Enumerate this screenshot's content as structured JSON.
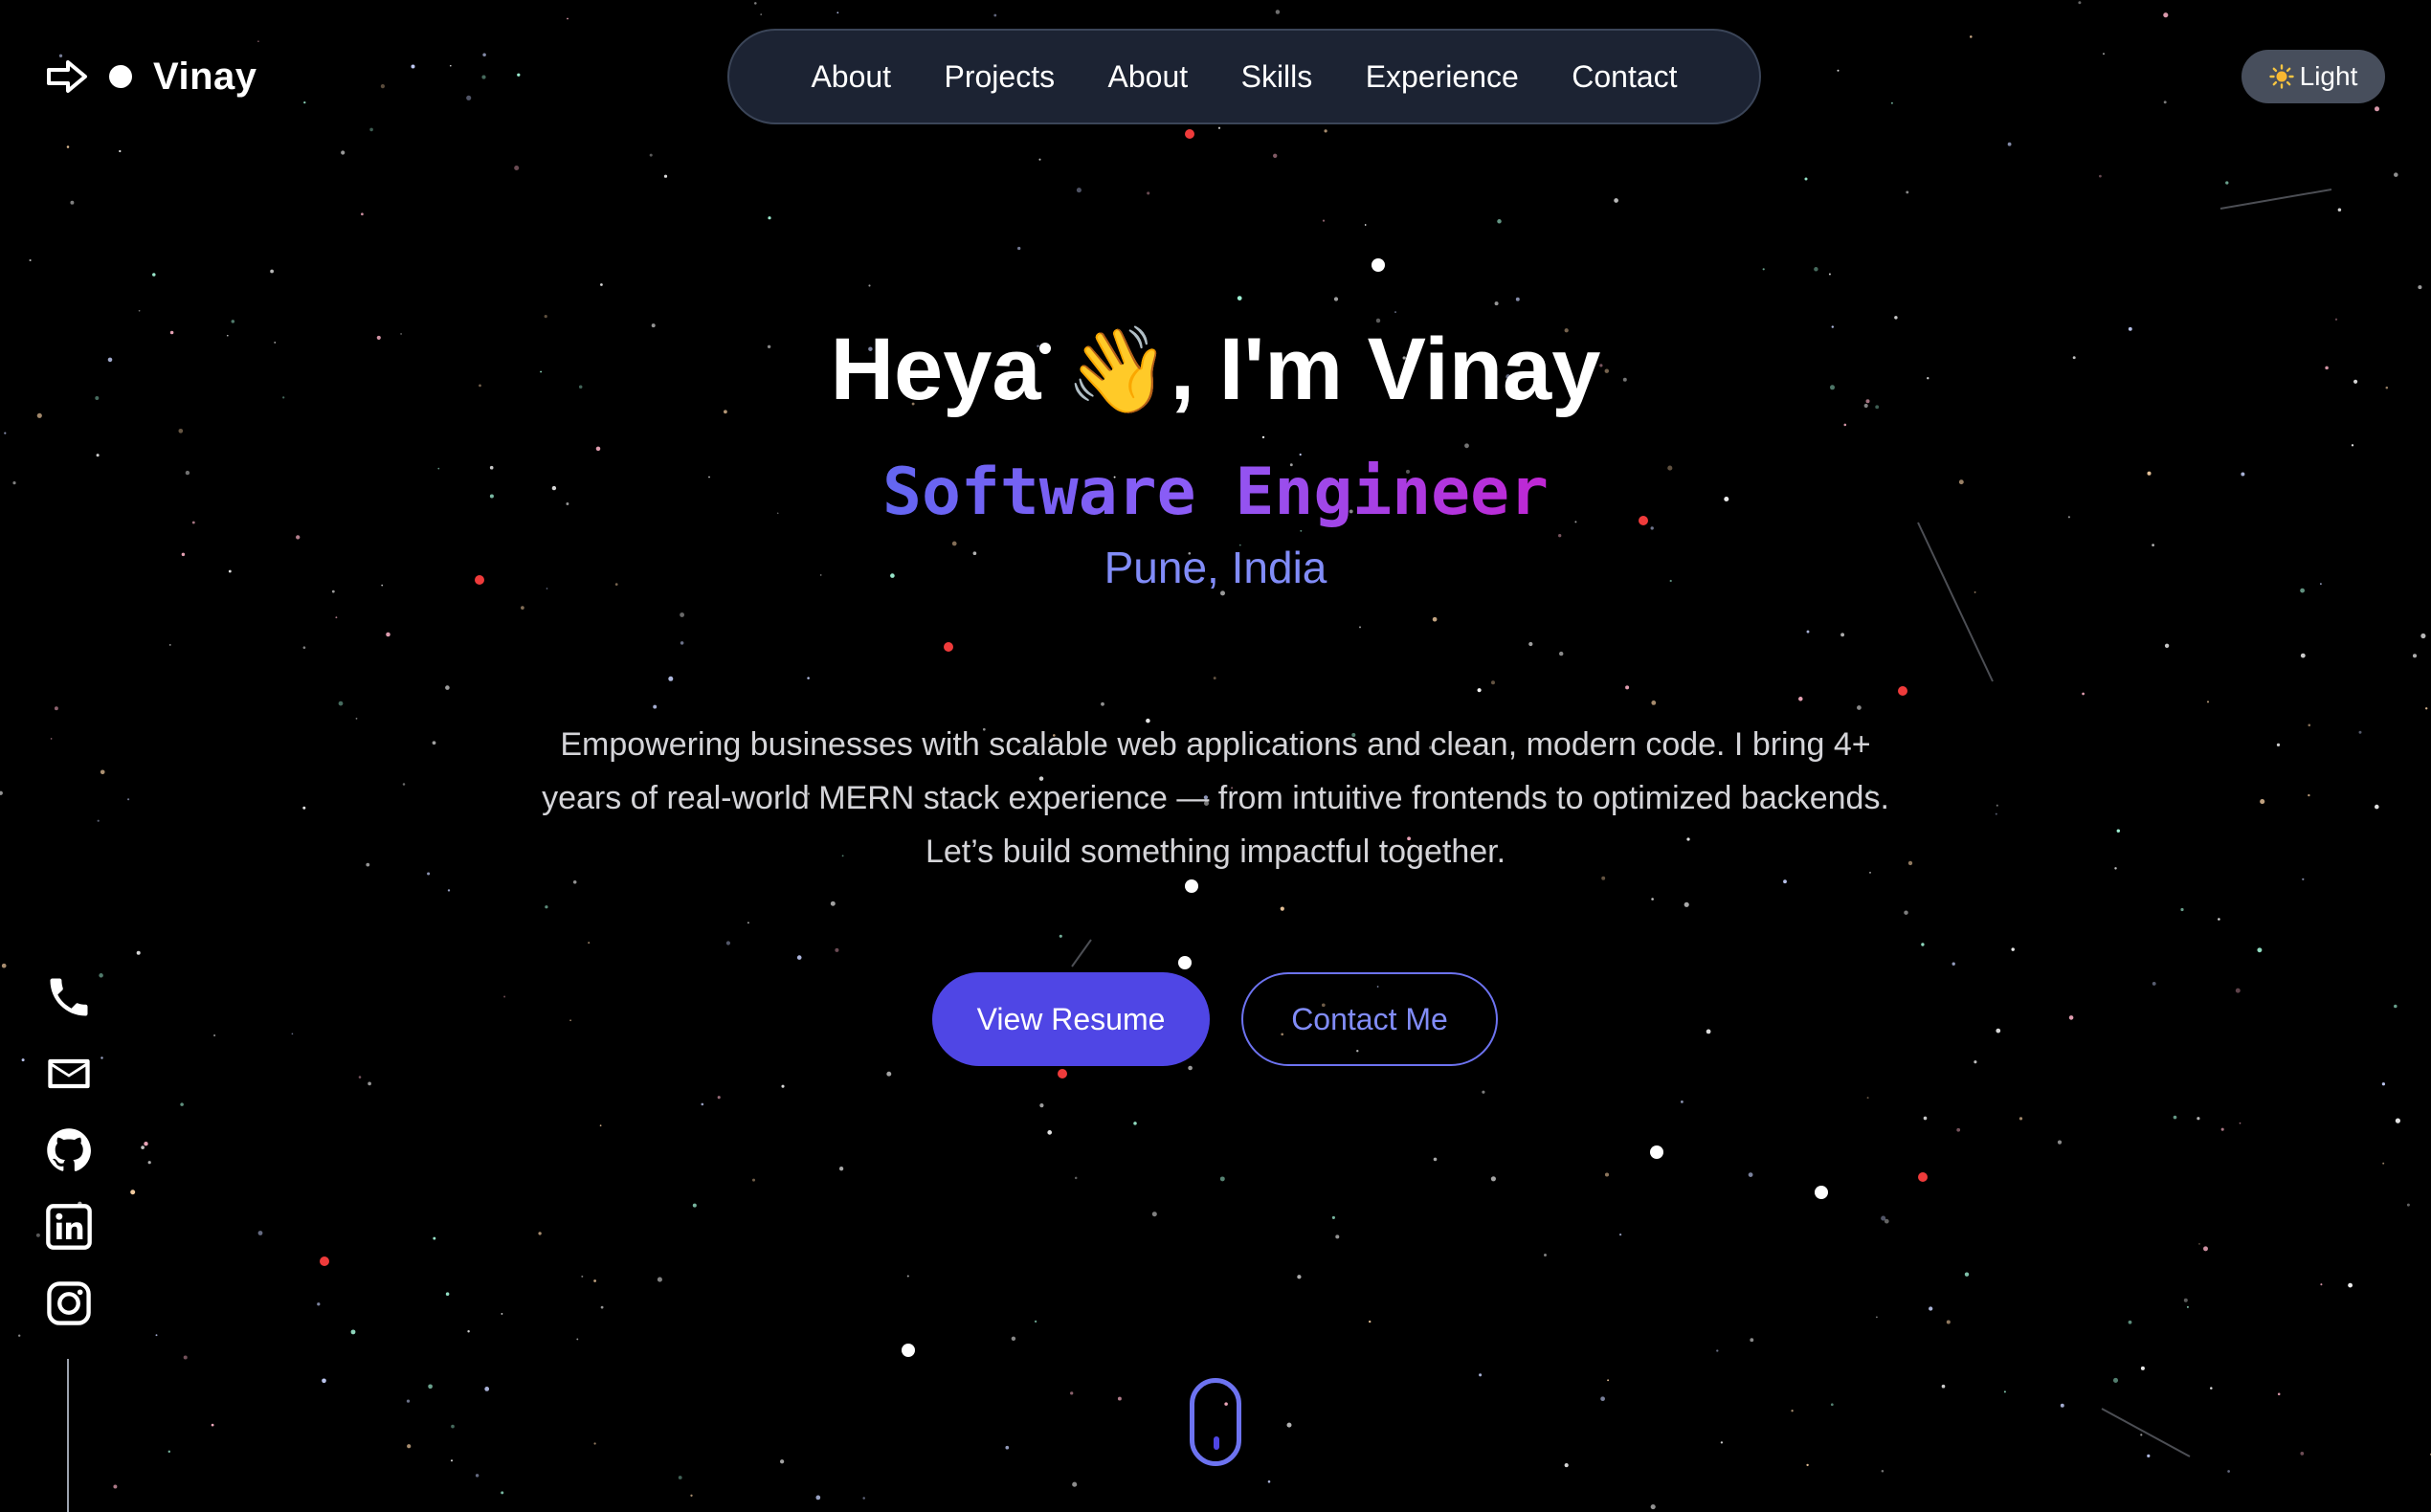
{
  "header": {
    "brand_name": "Vinay",
    "nav_items": [
      "About",
      "Projects",
      "About",
      "Skills",
      "Experience",
      "Contact"
    ],
    "theme_toggle_icon": "sun-icon",
    "theme_toggle_label": "Light"
  },
  "hero": {
    "greeting_before": "Heya",
    "greeting_emoji": "👋",
    "greeting_after": ", I'm Vinay",
    "role": "Software Engineer",
    "location": "Pune, India",
    "description": "Empowering businesses with scalable web applications and clean, modern code. I bring 4+ years of real-world MERN stack experience — from intuitive frontends to optimized backends. Let’s build something impactful together.",
    "primary_button": "View Resume",
    "secondary_button": "Contact Me"
  },
  "social": {
    "icons": [
      "phone-icon",
      "email-icon",
      "github-icon",
      "linkedin-icon",
      "instagram-icon"
    ]
  },
  "scroll_indicator_icon": "mouse-scroll-icon",
  "colors": {
    "background": "#000000",
    "nav_background": "#1c2333",
    "accent": "#4f46e5",
    "accent_light": "#818cf8",
    "gradient_start": "#6366f1",
    "gradient_end": "#c026d3",
    "toggle_background": "#474e5c"
  }
}
